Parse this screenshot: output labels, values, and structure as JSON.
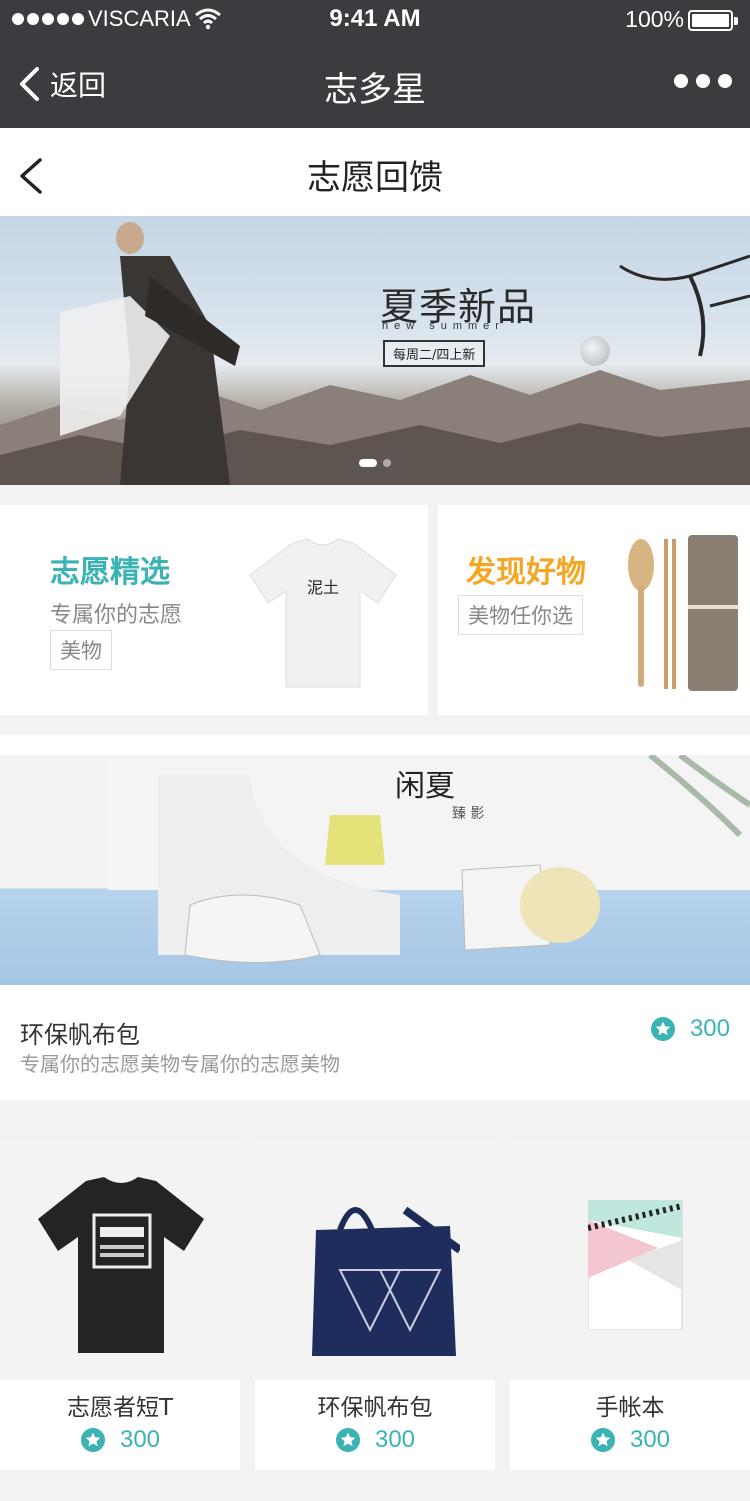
{
  "status": {
    "carrier": "VISCARIA",
    "time": "9:41 AM",
    "battery": "100%"
  },
  "nav": {
    "back_label": "返回",
    "title": "志多星"
  },
  "page": {
    "title": "志愿回馈"
  },
  "banner": {
    "title": "夏季新品",
    "subtitle": "new summer",
    "tag": "每周二/四上新"
  },
  "cards": [
    {
      "title": "志愿精选",
      "subtitle": "专属你的志愿",
      "tag": "美物",
      "color": "#3bb3b4"
    },
    {
      "title": "发现好物",
      "subtitle": "",
      "tag": "美物任你选",
      "color": "#f5a623"
    }
  ],
  "tshirt_print": "泥土",
  "featured": {
    "image_title": "闲夏",
    "image_text": "臻 影",
    "name": "环保帆布包",
    "description": "专属你的志愿美物专属你的志愿美物",
    "points": "300"
  },
  "products": [
    {
      "name": "志愿者短T",
      "points": "300"
    },
    {
      "name": "环保帆布包",
      "points": "300"
    },
    {
      "name": "手帐本",
      "points": "300"
    }
  ],
  "colors": {
    "accent": "#3bb3b4",
    "orange": "#f5a623",
    "topbar": "#3b3c40"
  },
  "icons": [
    "wifi-icon",
    "battery-icon",
    "back-chevron-icon",
    "more-icon",
    "star-icon"
  ]
}
